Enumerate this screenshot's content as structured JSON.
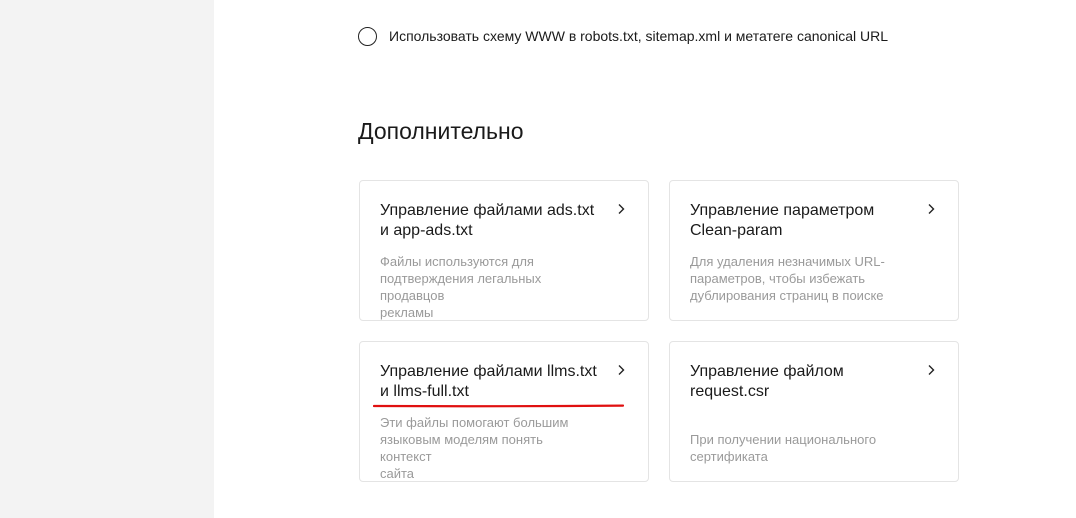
{
  "radio": {
    "label": "Использовать схему WWW в robots.txt, sitemap.xml и метатеге canonical URL",
    "checked": false
  },
  "section": {
    "title": "Дополнительно"
  },
  "cards": [
    {
      "title_line1": "Управление файлами ads.txt",
      "title_line2": "и app-ads.txt",
      "desc_line1": "Файлы используются для",
      "desc_line2": "подтверждения легальных продавцов",
      "desc_line3": "рекламы",
      "icon": "chevron-right-icon"
    },
    {
      "title_line1": "Управление параметром",
      "title_line2": "Clean-param",
      "desc_line1": "Для удаления незначимых URL-",
      "desc_line2": "параметров, чтобы избежать",
      "desc_line3": "дублирования страниц в поиске",
      "icon": "chevron-right-icon"
    },
    {
      "title_line1": "Управление файлами llms.txt",
      "title_line2": "и llms-full.txt",
      "desc_line1": "Эти файлы помогают большим",
      "desc_line2": "языковым моделям понять контекст",
      "desc_line3": "сайта",
      "icon": "chevron-right-icon"
    },
    {
      "title_line1": "Управление файлом",
      "title_line2": "request.csr",
      "desc_line1": "",
      "desc_line2": "При получении национального",
      "desc_line3": "сертификата",
      "icon": "chevron-right-icon"
    }
  ],
  "colors": {
    "sidebar_bg": "#f3f3f3",
    "card_border": "#e4e4e4",
    "desc_text": "#9a9a9a",
    "annotation_red": "#e01010"
  }
}
